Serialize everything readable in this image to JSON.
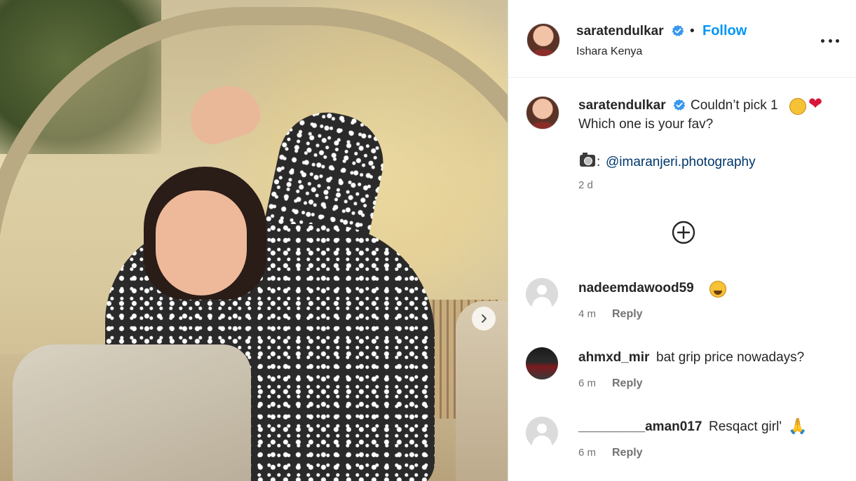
{
  "post": {
    "username": "saratendulkar",
    "follow_label": "Follow",
    "separator": "•",
    "location": "Ishara Kenya",
    "more_icon": "more-horizontal-icon"
  },
  "caption": {
    "username": "saratendulkar",
    "line1": "Couldn’t pick 1",
    "line2": "Which one is your fav?",
    "credit_prefix": ":",
    "mention": "@imaranjeri.photography",
    "time": "2 d",
    "emojis": [
      "smiling-face-emoji",
      "heart-emoji",
      "camera-emoji"
    ]
  },
  "load_more_icon": "plus-circle-icon",
  "comments": [
    {
      "username": "nadeemdawood59",
      "text": "",
      "emoji": "crying-face-emoji",
      "time": "4 m",
      "reply_label": "Reply"
    },
    {
      "username": "ahmxd_mir",
      "text": "bat grip price nowadays?",
      "time": "6 m",
      "reply_label": "Reply"
    },
    {
      "username": "_________aman017",
      "text": "Resqact girl'",
      "emoji": "folded-hands-emoji",
      "time": "6 m",
      "reply_label": "Reply"
    }
  ],
  "colors": {
    "accent": "#0095f6",
    "verified": "#3897f0",
    "mention": "#00376b",
    "secondary_text": "#737373"
  }
}
